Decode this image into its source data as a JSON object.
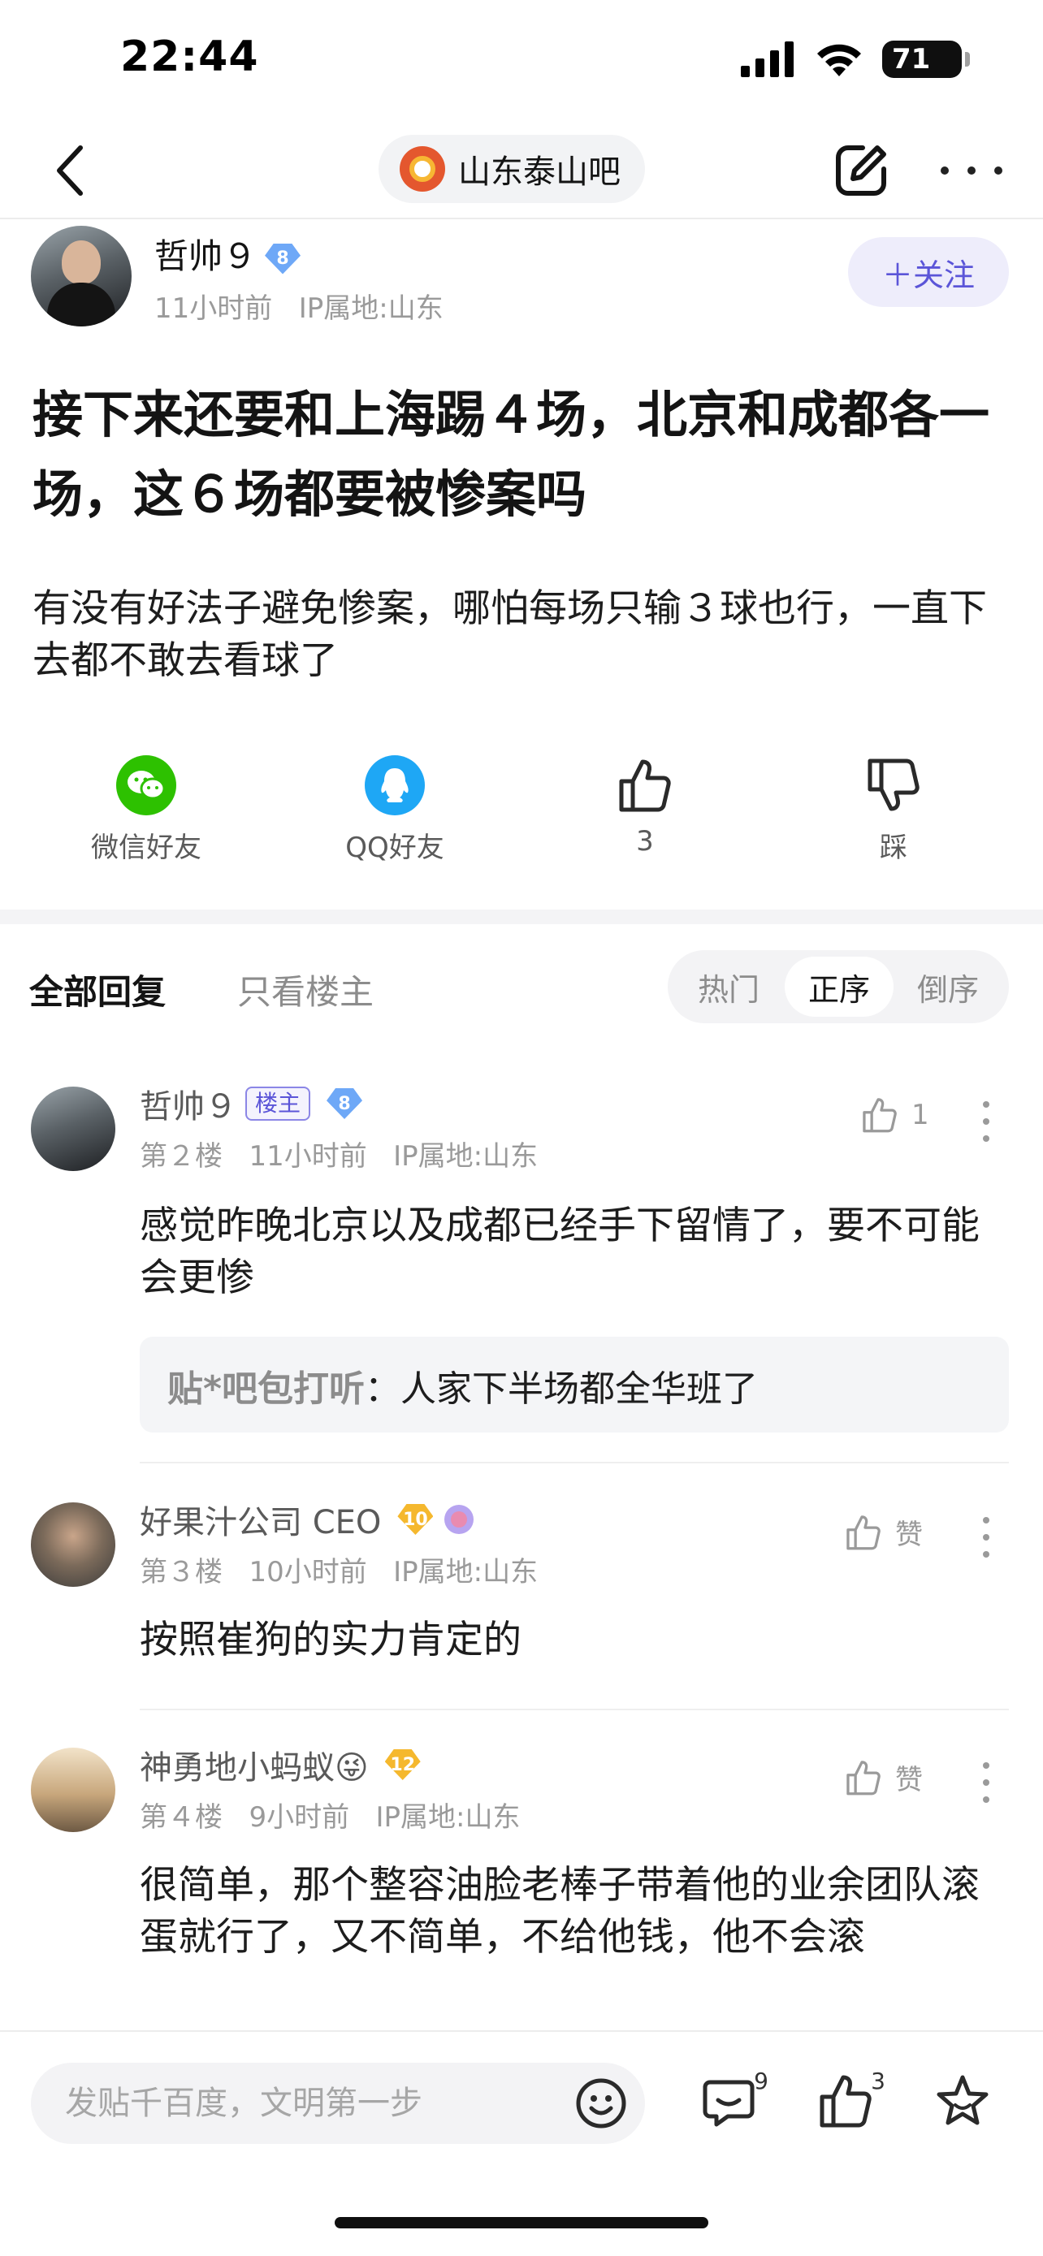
{
  "status_bar": {
    "time": "22:44",
    "battery": "71"
  },
  "nav": {
    "forum_name": "山东泰山吧"
  },
  "post": {
    "author": "哲帅９",
    "author_level": "8",
    "time": "11小时前",
    "ip": "IP属地:山东",
    "follow_label": "＋关注",
    "title": "接下来还要和上海踢４场，北京和成都各一场，这６场都要被惨案吗",
    "body": "有没有好法子避免惨案，哪怕每场只输３球也行，一直下去都不敢去看球了"
  },
  "share": [
    {
      "label": "微信好友",
      "icon": "wechat-icon",
      "color": "#2dc100"
    },
    {
      "label": "QQ好友",
      "icon": "qq-icon",
      "color": "#1ea7f5"
    },
    {
      "label": "3",
      "icon": "thumbs-up-icon"
    },
    {
      "label": "踩",
      "icon": "thumbs-down-icon"
    }
  ],
  "filters": {
    "all": "全部回复",
    "op_only": "只看楼主",
    "sort": [
      "热门",
      "正序",
      "倒序"
    ],
    "active_sort": "正序"
  },
  "replies": [
    {
      "name": "哲帅９",
      "op_badge": "楼主",
      "level": "8",
      "floor": "第２楼",
      "time": "11小时前",
      "ip": "IP属地:山东",
      "likes": "1",
      "text": "感觉昨晚北京以及成都已经手下留情了，要不可能会更惨",
      "quote_author": "贴*吧包打听",
      "quote_text": "：人家下半场都全华班了"
    },
    {
      "name": "好果汁公司 CEO",
      "level": "10",
      "floor": "第３楼",
      "time": "10小时前",
      "ip": "IP属地:山东",
      "likes": "赞",
      "text": "按照崔狗的实力肯定的"
    },
    {
      "name": "神勇地小蚂蚁😜",
      "level": "12",
      "floor": "第４楼",
      "time": "9小时前",
      "ip": "IP属地:山东",
      "likes": "赞",
      "text": "很简单，那个整容油脸老棒子带着他的业余团队滚蛋就行了，又不简单，不给他钱，他不会滚"
    }
  ],
  "bottom_bar": {
    "input_placeholder": "发贴千百度，文明第一步",
    "comment_count": "9",
    "like_count": "3"
  },
  "colors": {
    "accent": "#5b55d8",
    "follow_bg": "#eeedfb",
    "level_blue": "#6ea8f7",
    "level_gold": "#f5b82e"
  }
}
